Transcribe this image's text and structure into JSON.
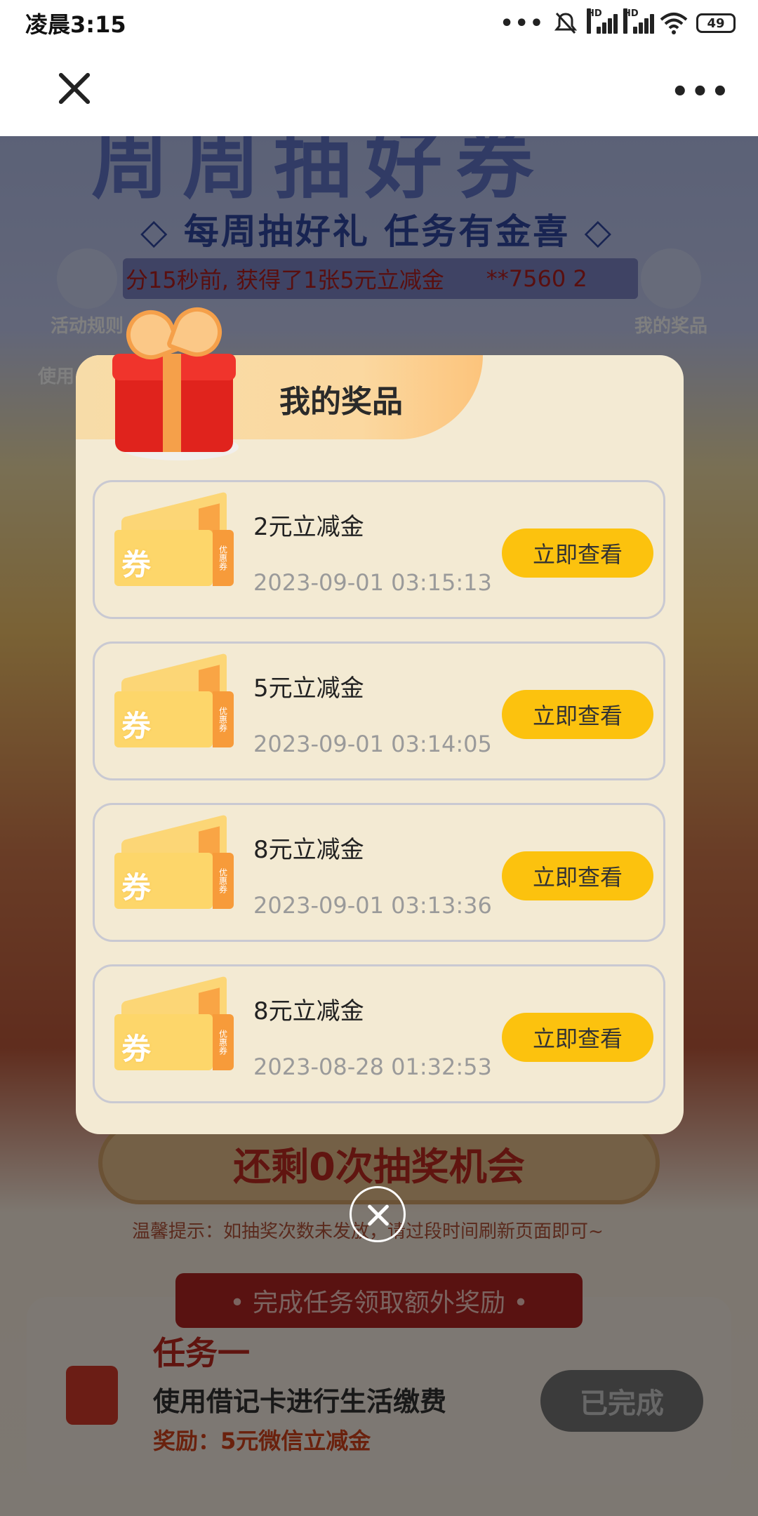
{
  "status_bar": {
    "time": "凌晨3:15",
    "dots": "•••",
    "hd1": "HD",
    "hd2": "HD",
    "battery": "49"
  },
  "app_bar": {
    "close_icon": "close-icon",
    "more_icon": "more-icon"
  },
  "background": {
    "big_title": "周周抽好券",
    "subtitle": "◇ 每周抽好礼 任务有金喜 ◇",
    "ticker_text": "分15秒前, 获得了1张5元立减金",
    "ticker_user": "**7560 2",
    "rules_label": "活动规则",
    "my_prizes_label": "我的奖品",
    "usage_label": "使用",
    "remaining_text": "还剩0次抽奖机会",
    "tip_text": "温馨提示：如抽奖次数未发放，请过段时间刷新页面即可~",
    "task_banner": "• 完成任务领取额外奖励 •",
    "task": {
      "title": "任务一",
      "desc": "使用借记卡进行生活缴费",
      "reward": "奖励：5元微信立减金",
      "button": "已完成"
    }
  },
  "modal": {
    "title": "我的奖品",
    "coupon_label": "券",
    "coupon_stub_text": "优惠券",
    "prizes": [
      {
        "name": "2元立减金",
        "time": "2023-09-01 03:15:13",
        "button": "立即查看"
      },
      {
        "name": "5元立减金",
        "time": "2023-09-01 03:14:05",
        "button": "立即查看"
      },
      {
        "name": "8元立减金",
        "time": "2023-09-01 03:13:36",
        "button": "立即查看"
      },
      {
        "name": "8元立减金",
        "time": "2023-08-28 01:32:53",
        "button": "立即查看"
      }
    ]
  },
  "colors": {
    "accent_button": "#fcc20e",
    "modal_bg": "#f3ead3",
    "ticker_red": "#b21f1f"
  }
}
